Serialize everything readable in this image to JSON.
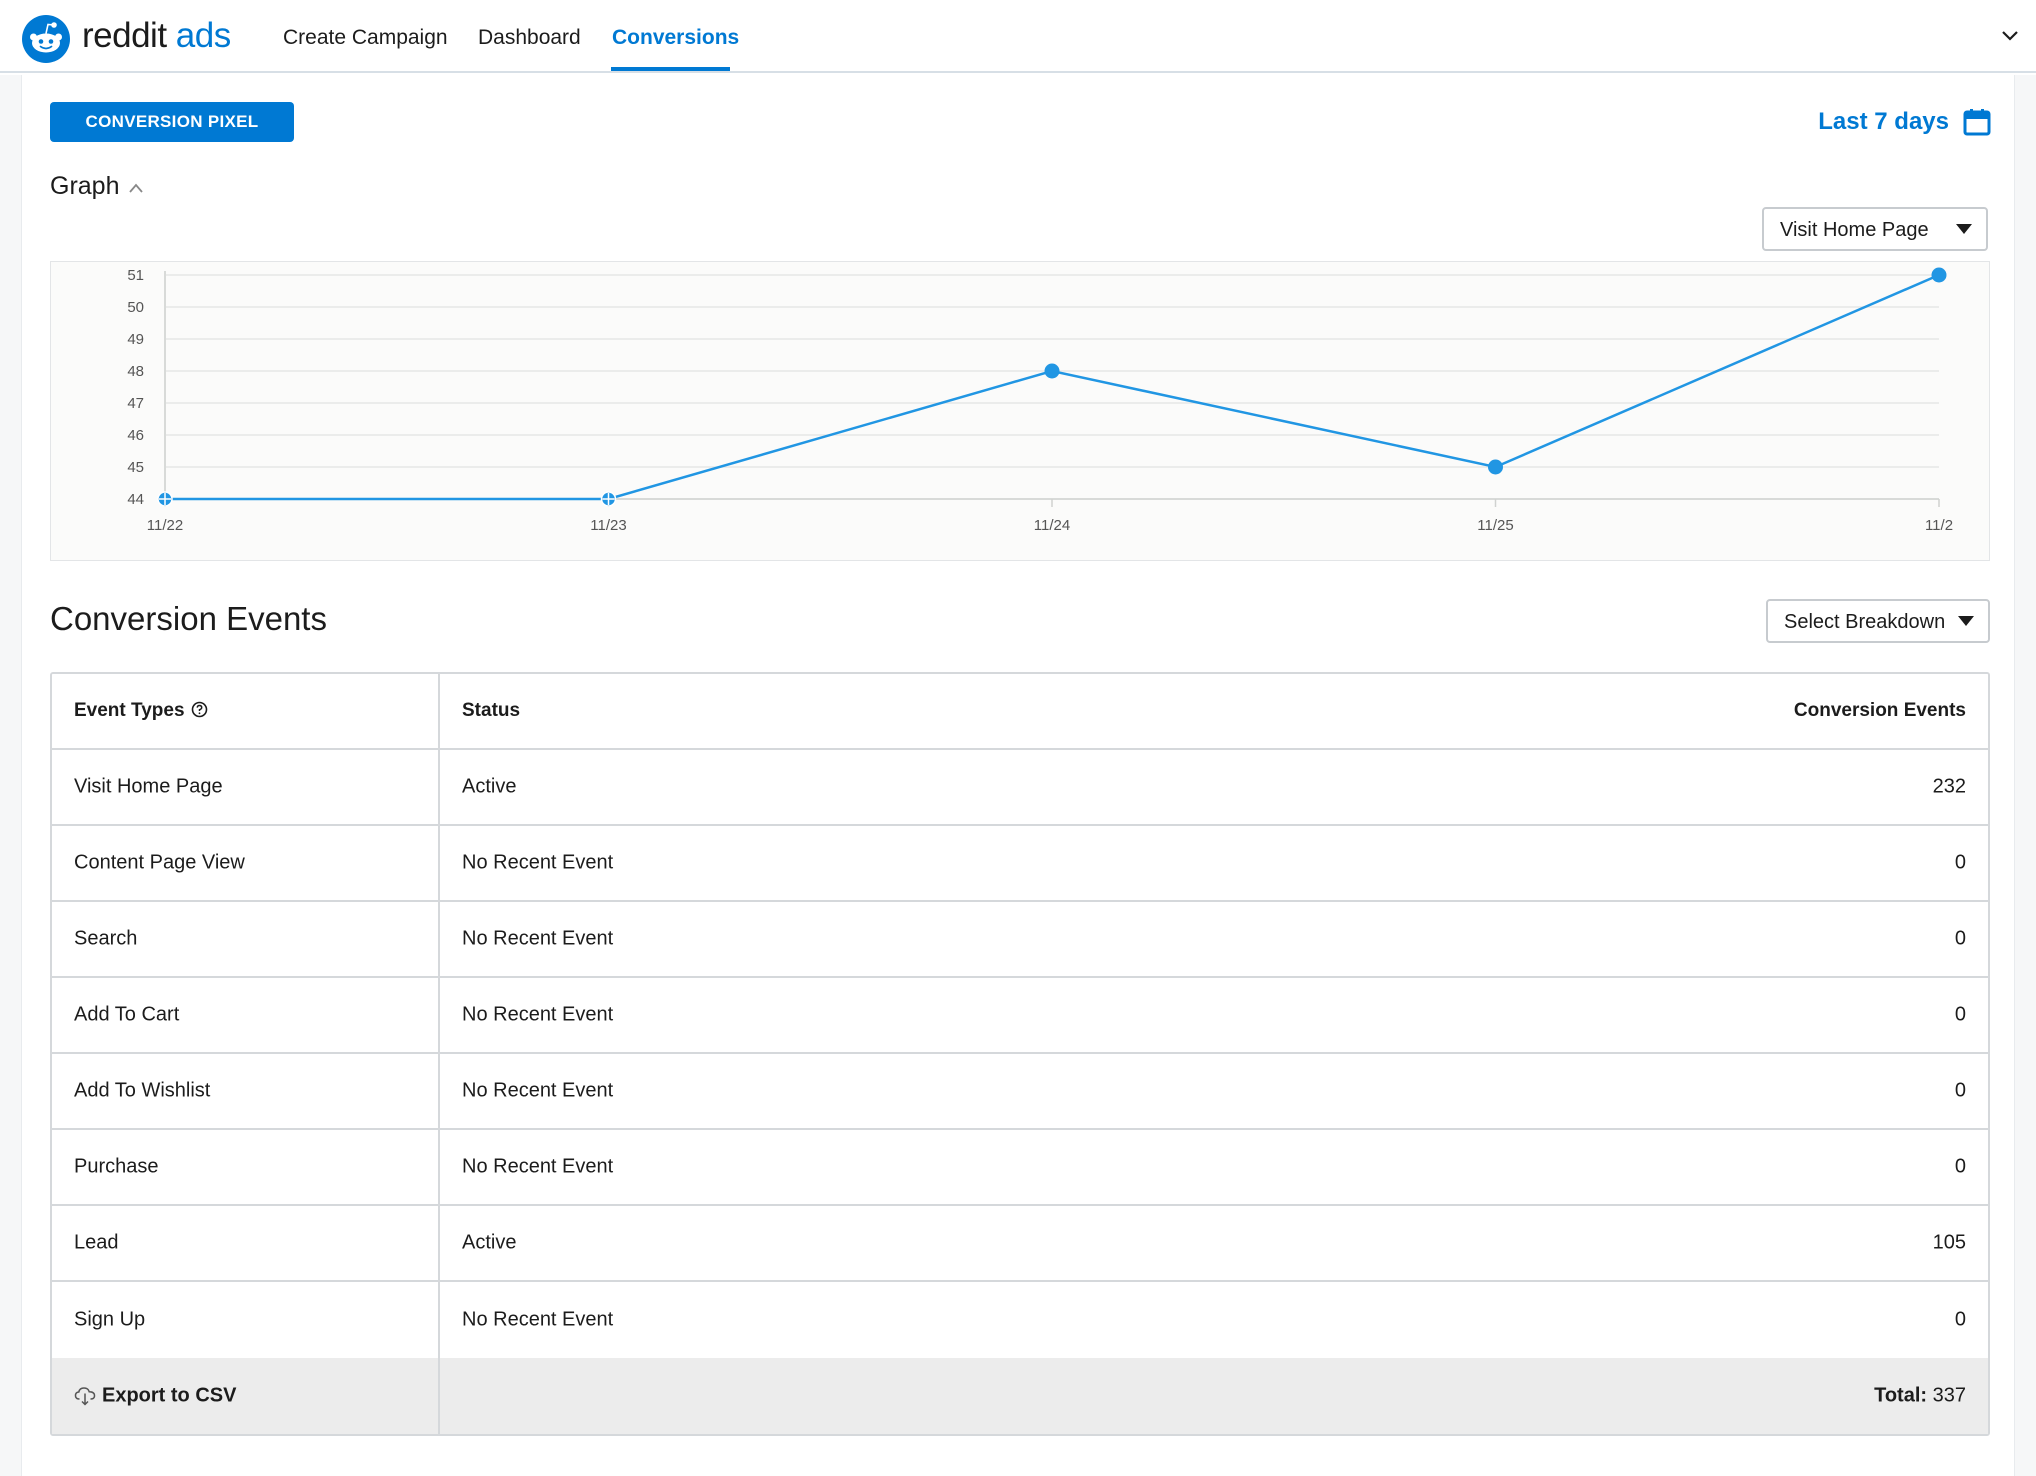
{
  "header": {
    "brand_main": "reddit",
    "brand_accent": "ads",
    "nav": [
      {
        "label": "Create Campaign"
      },
      {
        "label": "Dashboard"
      },
      {
        "label": "Conversions"
      }
    ],
    "active_nav": "Conversions"
  },
  "toolbar": {
    "pixel_button": "CONVERSION PIXEL",
    "date_range": "Last 7 days"
  },
  "graph": {
    "toggle_label": "Graph",
    "event_select": "Visit Home Page"
  },
  "chart_data": {
    "type": "line",
    "categories": [
      "11/22",
      "11/23",
      "11/24",
      "11/25",
      "11/2"
    ],
    "values": [
      44,
      44,
      48,
      45,
      51
    ],
    "ylim": [
      44,
      51
    ],
    "yticks": [
      44,
      45,
      46,
      47,
      48,
      49,
      50,
      51
    ],
    "grid": true,
    "colors": {
      "line": "#2196e3"
    }
  },
  "events": {
    "title": "Conversion Events",
    "breakdown_select": "Select Breakdown",
    "columns": [
      "Event Types",
      "Status",
      "Conversion Events"
    ],
    "rows": [
      {
        "type": "Visit Home Page",
        "status": "Active",
        "count": "232"
      },
      {
        "type": "Content Page View",
        "status": "No Recent Event",
        "count": "0"
      },
      {
        "type": "Search",
        "status": "No Recent Event",
        "count": "0"
      },
      {
        "type": "Add To Cart",
        "status": "No Recent Event",
        "count": "0"
      },
      {
        "type": "Add To Wishlist",
        "status": "No Recent Event",
        "count": "0"
      },
      {
        "type": "Purchase",
        "status": "No Recent Event",
        "count": "0"
      },
      {
        "type": "Lead",
        "status": "Active",
        "count": "105"
      },
      {
        "type": "Sign Up",
        "status": "No Recent Event",
        "count": "0"
      }
    ],
    "export_label": "Export to CSV",
    "total_label": "Total:",
    "total_value": "337"
  },
  "colors": {
    "accent": "#0079d3"
  }
}
